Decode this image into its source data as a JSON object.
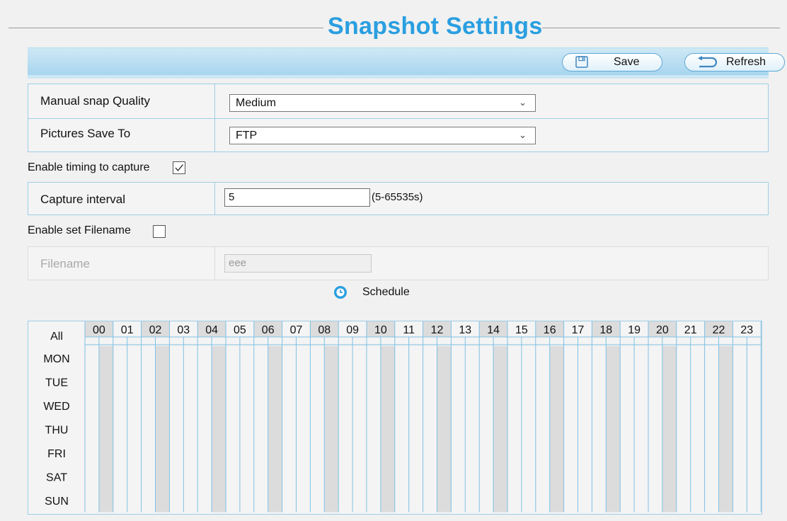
{
  "page": {
    "title": "Snapshot Settings"
  },
  "toolbar": {
    "save_label": "Save",
    "refresh_label": "Refresh",
    "save_icon": "floppy-disk-icon",
    "refresh_icon": "refresh-arrow-icon"
  },
  "settings": {
    "manual_snap_quality": {
      "label": "Manual snap Quality",
      "value": "Medium"
    },
    "pictures_save_to": {
      "label": "Pictures Save To",
      "value": "FTP"
    }
  },
  "timing": {
    "label": "Enable timing to capture",
    "checked": true,
    "capture_interval": {
      "label": "Capture interval",
      "value": "5",
      "hint": "(5-65535s)"
    }
  },
  "filename": {
    "label": "Enable set Filename",
    "checked": false,
    "field": {
      "label": "Filename",
      "value": "eee"
    }
  },
  "schedule": {
    "label": "Schedule",
    "icon": "clock-icon",
    "all_label": "All",
    "hours": [
      "00",
      "01",
      "02",
      "03",
      "04",
      "05",
      "06",
      "07",
      "08",
      "09",
      "10",
      "11",
      "12",
      "13",
      "14",
      "15",
      "16",
      "17",
      "18",
      "19",
      "20",
      "21",
      "22",
      "23"
    ],
    "days": [
      "MON",
      "TUE",
      "WED",
      "THU",
      "FRI",
      "SAT",
      "SUN"
    ],
    "selected_slots": []
  },
  "colors": {
    "accent": "#2a9fe0",
    "grid_line": "#7fc0e4",
    "shade": "#dcdcdc"
  }
}
